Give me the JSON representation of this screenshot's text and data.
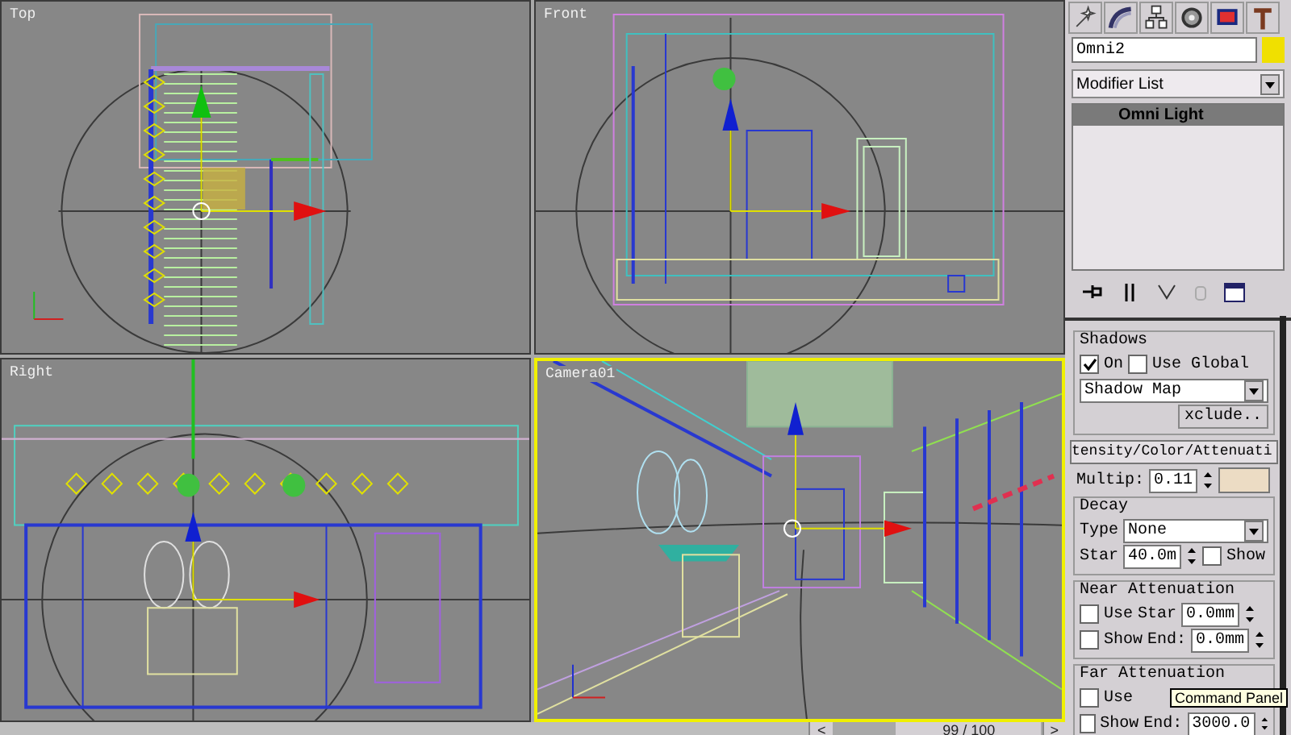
{
  "viewports": [
    {
      "label": "Top",
      "kind": "top",
      "active": false
    },
    {
      "label": "Front",
      "kind": "front",
      "active": false
    },
    {
      "label": "Right",
      "kind": "right",
      "active": false
    },
    {
      "label": "Camera01",
      "kind": "camera",
      "active": true
    }
  ],
  "time_slider": {
    "prev": "<",
    "position": "99 / 100",
    "level": 0.99,
    "next": ">"
  },
  "command_panel": {
    "object_name": "Omni2",
    "modifier_list": "Modifier List",
    "stack": [
      {
        "label": "Omni Light",
        "selected": true
      }
    ],
    "shadows": {
      "title": "Shadows",
      "on": {
        "label": "On",
        "checked": true
      },
      "use_global": {
        "label": "Use Global",
        "checked": false
      },
      "type": "Shadow Map",
      "exclude": "xclude.."
    },
    "intensity": {
      "title": "tensity/Color/Attenuati",
      "multiplier_label": "Multip:",
      "multiplier": "0.11"
    },
    "decay": {
      "title": "Decay",
      "type_label": "Type",
      "type": "None",
      "start_label": "Star",
      "start": "40.0m",
      "show": {
        "label": "Show",
        "checked": false
      }
    },
    "near_attenuation": {
      "title": "Near Attenuation",
      "use": {
        "label": "Use",
        "checked": false
      },
      "show": {
        "label": "Show",
        "checked": false
      },
      "start_label": "Star",
      "start": "0.0mm",
      "end_label": "End:",
      "end": "0.0mm"
    },
    "far_attenuation": {
      "title": "Far Attenuation",
      "use": {
        "label": "Use",
        "checked": false
      },
      "show": {
        "label": "Show",
        "checked": false
      },
      "end_label": "End:",
      "end": "3000.0"
    },
    "tooltip": "Command Panel"
  }
}
